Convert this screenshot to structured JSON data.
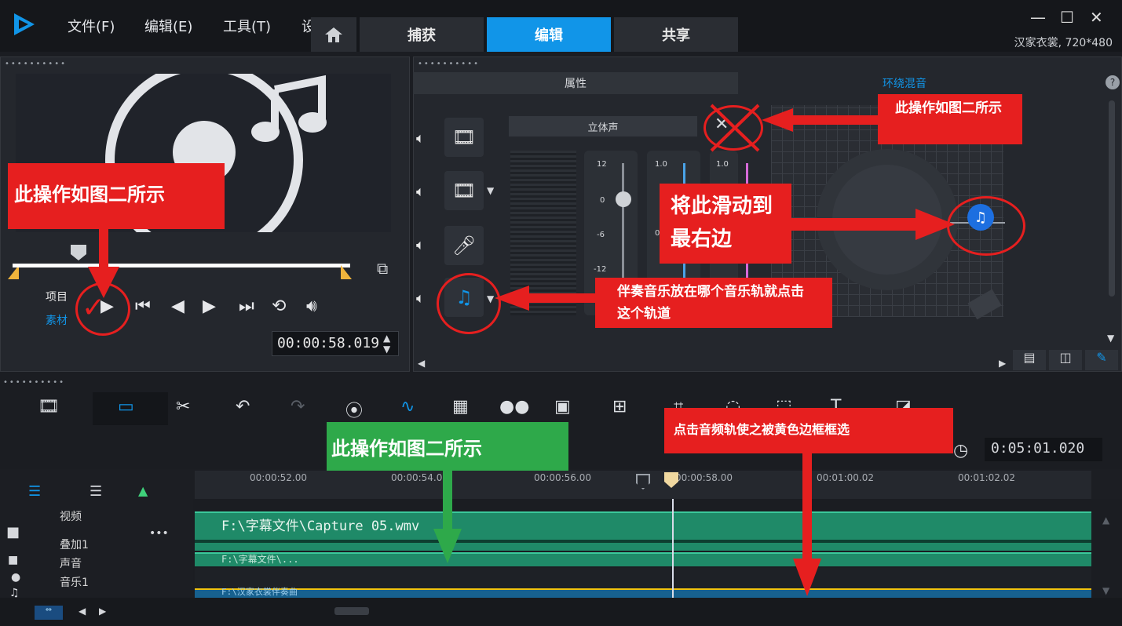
{
  "menu": {
    "file": "文件(F)",
    "edit": "编辑(E)",
    "tools": "工具(T)",
    "more": "设"
  },
  "tabs": {
    "capture": "捕获",
    "edit": "编辑",
    "share": "共享"
  },
  "status": {
    "resolution": "汉家衣裳, 720*480"
  },
  "player": {
    "project_label": "项目",
    "clip_label": "素材",
    "timecode": "00:00:58.019"
  },
  "mixer": {
    "properties_tab": "属性",
    "surround_tab": "环绕混音",
    "stereo_label": "立体声",
    "scale1": [
      "12",
      "0",
      "-6",
      "-12"
    ],
    "scale2": "1.0",
    "scale3": "1.0",
    "zero2": "0"
  },
  "annotations": {
    "note_top_right": "此操作如图二所示",
    "note_slide": "将此滑动到最右边",
    "note_track": "伴奏音乐放在哪个音乐轨就点击这个轨道",
    "note_player": "此操作如图二所示",
    "note_timeline": "此操作如图二所示",
    "note_audio": "点击音频轨使之被黄色边框框选"
  },
  "timeline": {
    "duration": "0:05:01.020",
    "ruler": [
      "00:00:52.00",
      "00:00:54.00",
      "00:00:56.00",
      "00:00:58.00",
      "00:01:00.02",
      "00:01:02.02"
    ],
    "track_labels": {
      "video": "视频",
      "overlay": "叠加1",
      "voice": "声音",
      "music": "音乐1"
    },
    "clip_video": "F:\\字幕文件\\Capture 05.wmv",
    "clip_overlay": "F:\\字幕文件\\...",
    "clip_music": "F:\\汉家衣裳伴奏曲"
  },
  "colors": {
    "accent": "#1195e8",
    "annotation_red": "#e61f1f",
    "annotation_green": "#2ea94a",
    "clip_green": "#1f8a68"
  }
}
